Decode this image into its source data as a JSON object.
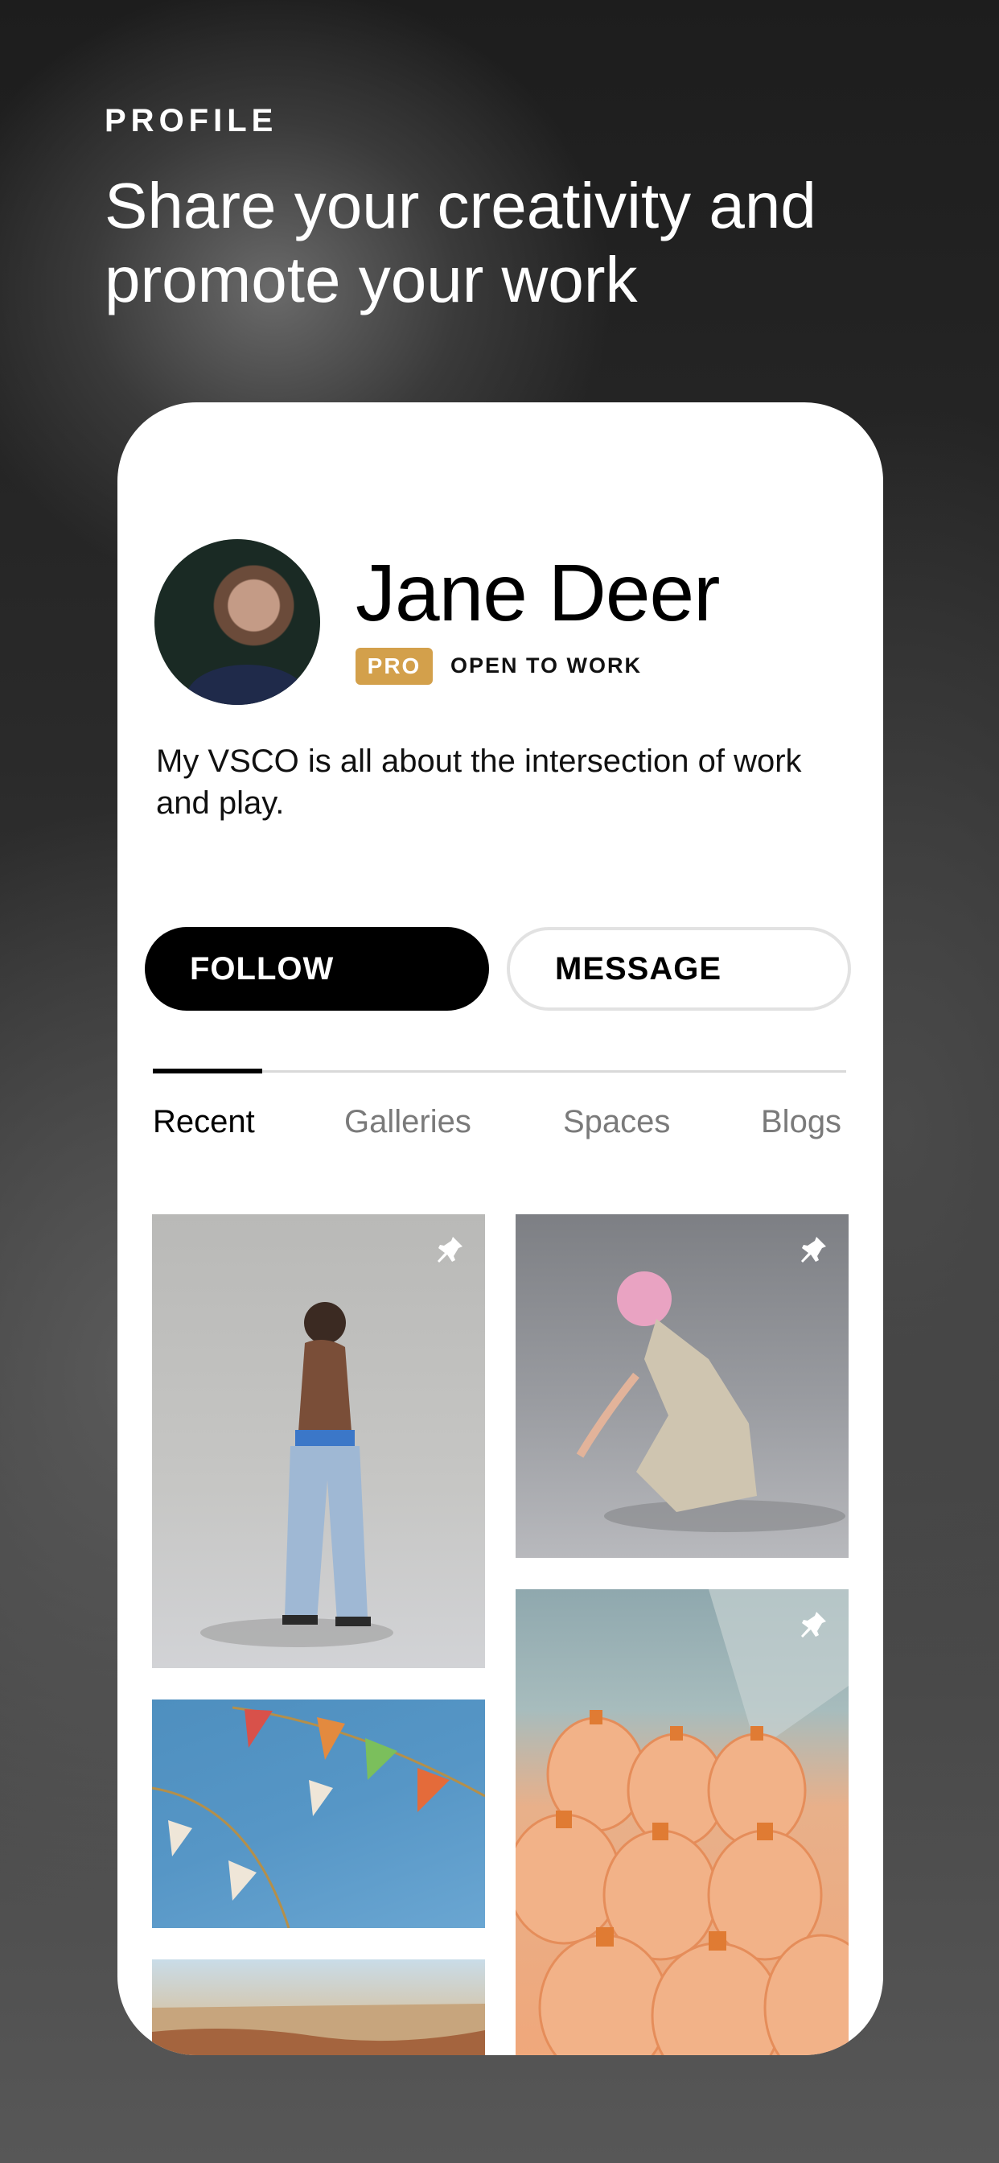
{
  "header": {
    "eyebrow": "PROFILE",
    "headline": "Share your creativity and promote your work"
  },
  "profile": {
    "name": "Jane Deer",
    "badge": "PRO",
    "status": "OPEN TO WORK",
    "bio": "My VSCO is all about the intersection of work and play."
  },
  "actions": {
    "follow_label": "FOLLOW",
    "message_label": "MESSAGE"
  },
  "tabs": [
    {
      "label": "Recent",
      "active": true
    },
    {
      "label": "Galleries",
      "active": false
    },
    {
      "label": "Spaces",
      "active": false
    },
    {
      "label": "Blogs",
      "active": false
    }
  ],
  "grid": {
    "pinned_icon": "pin-icon",
    "items": [
      {
        "subject": "model-in-jeans",
        "pinned": true
      },
      {
        "subject": "model-pink-hair",
        "pinned": true
      },
      {
        "subject": "flag-bunting",
        "pinned": false
      },
      {
        "subject": "water-bottles",
        "pinned": true
      },
      {
        "subject": "desert-canyon",
        "pinned": false
      }
    ]
  },
  "colors": {
    "badge_bg": "#d3a04b",
    "primary_button": "#000000",
    "tab_inactive": "#7a7a7a"
  }
}
